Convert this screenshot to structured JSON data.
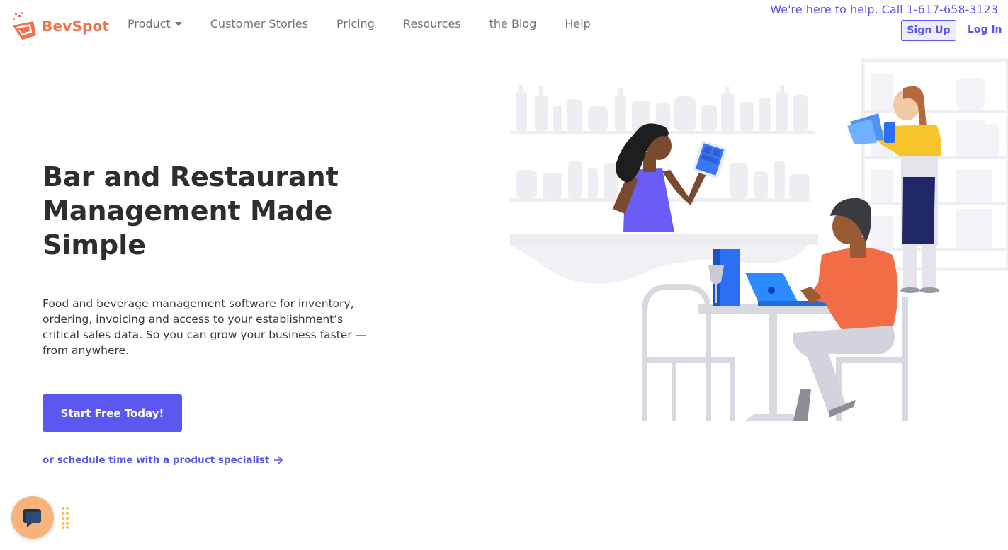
{
  "header": {
    "brand": "BevSpot",
    "nav": [
      {
        "label": "Product",
        "has_dropdown": true
      },
      {
        "label": "Customer Stories"
      },
      {
        "label": "Pricing"
      },
      {
        "label": "Resources"
      },
      {
        "label": "the Blog"
      },
      {
        "label": "Help"
      }
    ],
    "help_text": "We're here to help. Call 1-617-658-3123",
    "signup_label": "Sign Up",
    "login_label": "Log In"
  },
  "hero": {
    "title": "Bar and Restaurant Management Made Simple",
    "description": "Food and beverage management software for inventory, ordering, invoicing and access to your establishment’s critical sales data. So you can grow your business faster —from anywhere.",
    "cta_label": "Start Free Today!",
    "schedule_label": "or schedule time with a product specialist"
  },
  "colors": {
    "brand": "#f0714b",
    "accent": "#5b57f0",
    "chat": "#f6b37c"
  },
  "icons": [
    "logo-icon",
    "chevron-down-icon",
    "arrow-right-icon",
    "chat-icon",
    "drag-handle-icon"
  ]
}
